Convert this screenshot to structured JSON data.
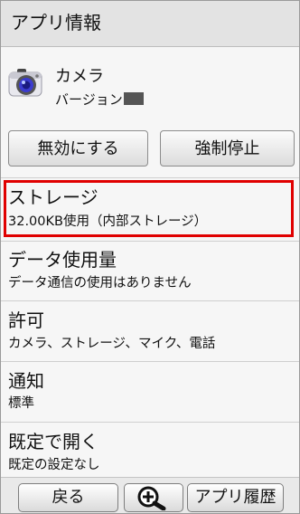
{
  "header": {
    "title": "アプリ情報"
  },
  "app": {
    "icon": "camera-icon",
    "name": "カメラ",
    "version_label": "バージョン"
  },
  "buttons": {
    "disable": "無効にする",
    "force_stop": "強制停止"
  },
  "items": [
    {
      "title": "ストレージ",
      "subtitle": "32.00KB使用（内部ストレージ）",
      "highlighted": true
    },
    {
      "title": "データ使用量",
      "subtitle": "データ通信の使用はありません"
    },
    {
      "title": "許可",
      "subtitle": "カメラ、ストレージ、マイク、電話"
    },
    {
      "title": "通知",
      "subtitle": "標準"
    },
    {
      "title": "既定で開く",
      "subtitle": "既定の設定なし"
    }
  ],
  "bottom_bar": {
    "back": "戻る",
    "zoom_icon": "zoom-in-icon",
    "history": "アプリ履歴"
  },
  "colors": {
    "highlight": "#e00000",
    "header_bg": "#e3e3e3"
  }
}
